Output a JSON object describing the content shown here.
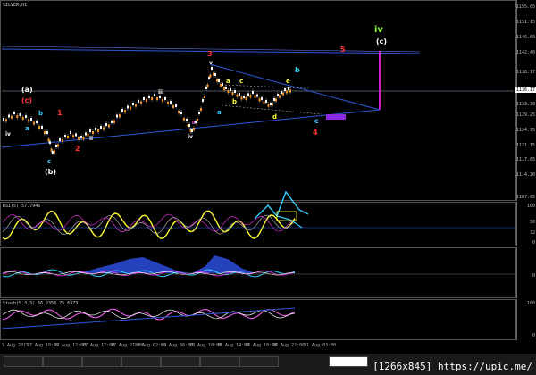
{
  "window": {
    "symbol_title": "SILVER,H1",
    "watermark": "[1266x845] https://upic.me/"
  },
  "main_axis": {
    "ticks": [
      "1155.65",
      "1151.15",
      "1146.65",
      "1142.40",
      "1138.17",
      "1133.30",
      "1129.25",
      "1124.75",
      "1121.15",
      "1117.65",
      "1114.20",
      "1107.65"
    ],
    "current_price": "1136.17"
  },
  "rsi_panel": {
    "title": "RSI(5) 57.7946",
    "ticks": [
      "100",
      "50",
      "32",
      "0"
    ]
  },
  "macd_panel": {
    "ticks": [
      "0"
    ]
  },
  "stoch_panel": {
    "title": "Stoch(5,3,3) 66.2356 75.6373",
    "ticks": [
      "100",
      "0"
    ]
  },
  "x_axis": {
    "labels": [
      "7 Aug 2015",
      "27 Aug 10:00",
      "27 Aug 12:00",
      "27 Aug 17:00",
      "27 Aug 21:00",
      "28 Aug 02:00",
      "28 Aug 06:00",
      "28 Aug 10:00",
      "28 Aug 14:00",
      "28 Aug 18:00",
      "28 Aug 22:00",
      "31 Aug 03:00"
    ]
  },
  "tabs": [
    "",
    "",
    "",
    "",
    "",
    "",
    "",
    ""
  ],
  "wave_labels": {
    "iv_green": "iv",
    "c_paren": "(c)",
    "a_paren": "(a)",
    "c_red_paren": "(c)",
    "b_paren": "(b)",
    "three": "3",
    "five": "5",
    "four": "4",
    "one": "1",
    "two": "2",
    "iii": "iii",
    "iv_small": "iv",
    "ii": "ii",
    "v": "v",
    "iv_left": "iv",
    "a_left": "a",
    "b_left": "b",
    "c_left": "c",
    "a_mid": "a",
    "a_top": "a",
    "b_mid": "b",
    "c_top": "c",
    "d": "d",
    "e": "e",
    "b_cyan": "b",
    "c_cyan": "c",
    "ii_small": "ii",
    "i_small": "i"
  },
  "colors": {
    "candle_up": "#f7931e",
    "candle_down": "#ffffff",
    "trendline": "#2f58d8",
    "projection_magenta": "#d21bd2",
    "rsi_line": "#ffff33",
    "accent_cyan": "#33ccff"
  }
}
